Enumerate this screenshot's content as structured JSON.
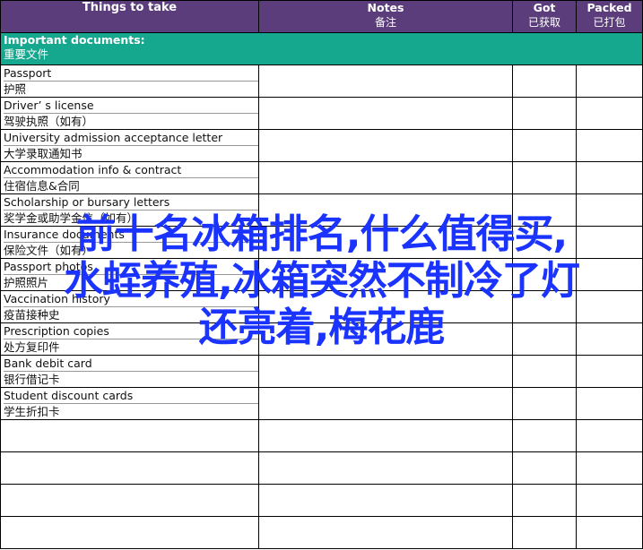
{
  "header": {
    "col1": "Things to take",
    "col2_en": "Notes",
    "col2_zh": "备注",
    "col3_en": "Got",
    "col3_zh": "已获取",
    "col4_en": "Packed",
    "col4_zh": "已打包"
  },
  "section": {
    "en": "Important documents:",
    "zh": "重要文件"
  },
  "items": [
    {
      "en": "Passport",
      "zh": "护照"
    },
    {
      "en": "Driver’ s license",
      "zh": "驾驶执照（如有）"
    },
    {
      "en": "University admission acceptance letter",
      "zh": "大学录取通知书"
    },
    {
      "en": "Accommodation info & contract",
      "zh": "住宿信息&合同"
    },
    {
      "en": "Scholarship or bursary letters",
      "zh": "奖学金或助学金信（如有）"
    },
    {
      "en": "Insurance documents",
      "zh": "保险文件（如有）"
    },
    {
      "en": "Passport photos",
      "zh": "护照照片"
    },
    {
      "en": "Vaccination history",
      "zh": "疫苗接种史"
    },
    {
      "en": "Prescription copies",
      "zh": "处方复印件"
    },
    {
      "en": "Bank debit card",
      "zh": "银行借记卡"
    },
    {
      "en": "Student discount cards",
      "zh": "学生折扣卡"
    }
  ],
  "overlay": {
    "line1": "前十名冰箱排名,什么值得买,",
    "line2": "水蛭养殖,冰箱突然不制冷了灯",
    "line3": "还亮着,梅花鹿"
  },
  "colors": {
    "header_bg": "#5a3d7a",
    "section_bg": "#16a88e",
    "overlay_text": "#1a33ff"
  }
}
